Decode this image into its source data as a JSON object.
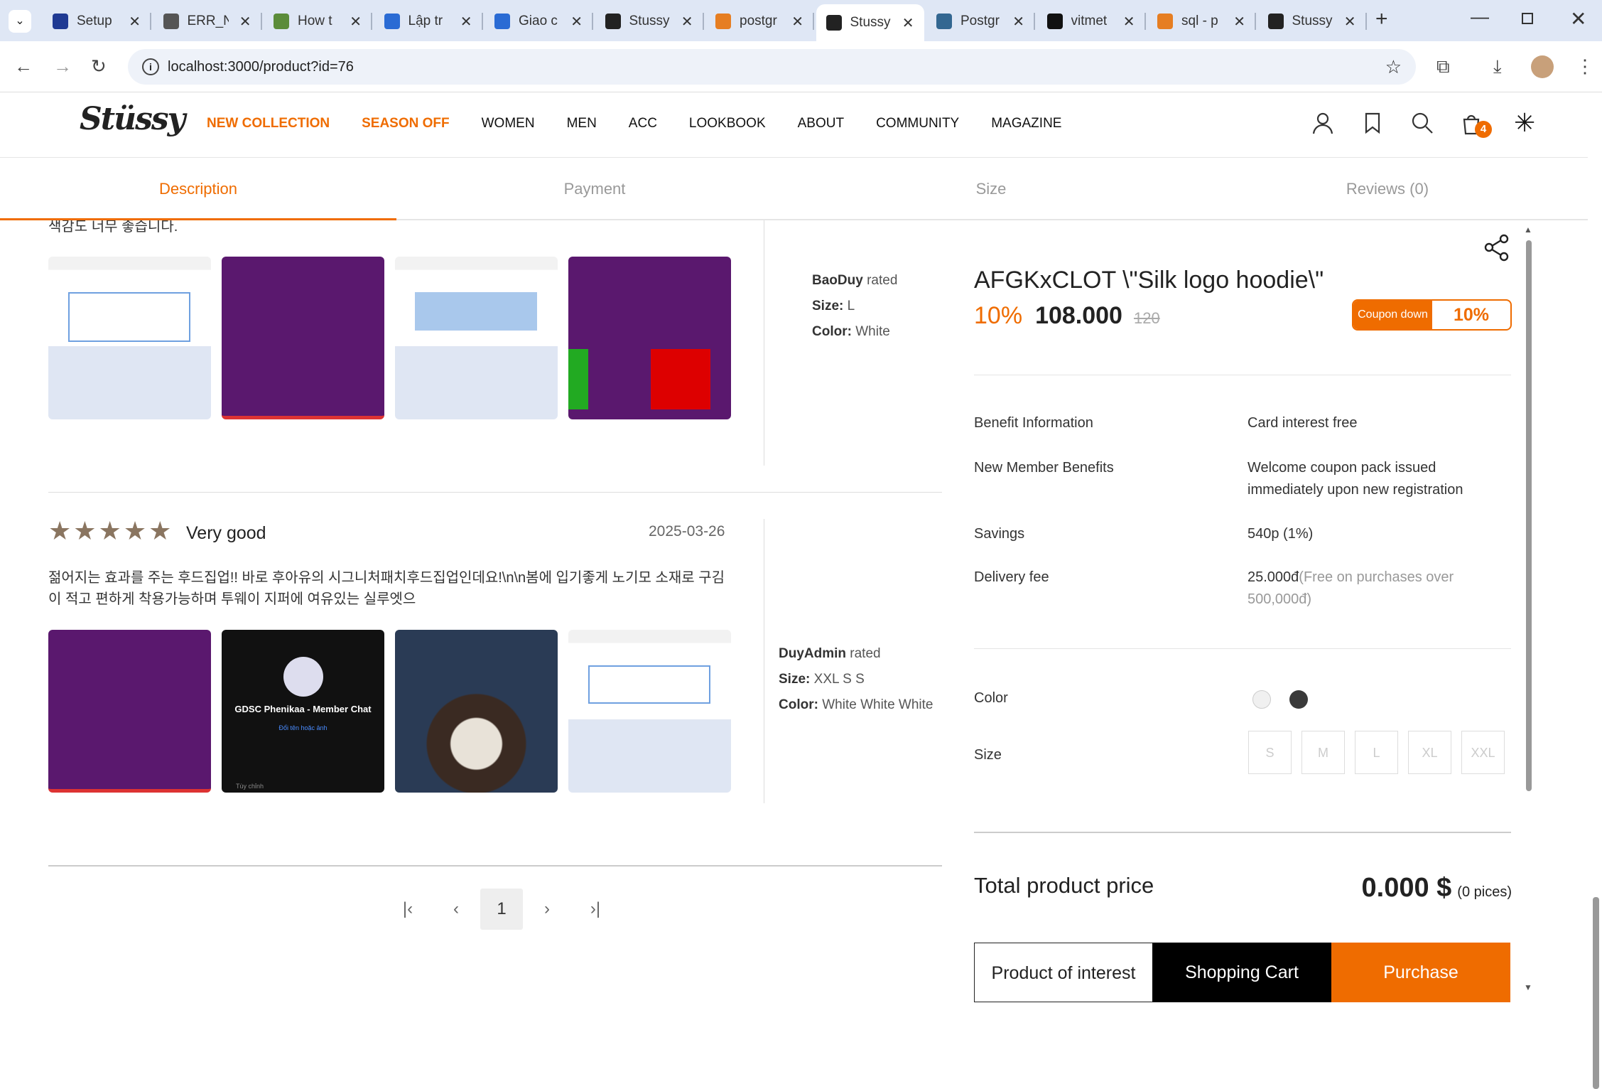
{
  "browser": {
    "tabs": [
      {
        "title": "Setup",
        "icon": "n-icon",
        "color": "#1f3a93",
        "active": false
      },
      {
        "title": "ERR_N",
        "icon": "globe-icon",
        "color": "#555",
        "active": false
      },
      {
        "title": "How t",
        "icon": "green-icon",
        "color": "#5b8c3a",
        "active": false
      },
      {
        "title": "Lập tr",
        "icon": "diamond-icon",
        "color": "#2a6bd4",
        "active": false
      },
      {
        "title": "Giao c",
        "icon": "diamond-icon",
        "color": "#2a6bd4",
        "active": false
      },
      {
        "title": "Stussy",
        "icon": "stussy-icon",
        "color": "#222",
        "active": false
      },
      {
        "title": "postgr",
        "icon": "stack-icon",
        "color": "#e67e22",
        "active": false
      },
      {
        "title": "Stussy",
        "icon": "stussy-icon",
        "color": "#222",
        "active": true
      },
      {
        "title": "Postgr",
        "icon": "elephant-icon",
        "color": "#336791",
        "active": false
      },
      {
        "title": "vitmet",
        "icon": "github-icon",
        "color": "#111",
        "active": false
      },
      {
        "title": "sql - p",
        "icon": "stack-icon",
        "color": "#e67e22",
        "active": false
      },
      {
        "title": "Stussy",
        "icon": "stussy-icon",
        "color": "#222",
        "active": false
      }
    ],
    "url": "localhost:3000/product?id=76"
  },
  "site": {
    "logo": "Stüssy",
    "menu": [
      "NEW COLLECTION",
      "SEASON OFF",
      "WOMEN",
      "MEN",
      "ACC",
      "LOOKBOOK",
      "ABOUT",
      "COMMUNITY",
      "MAGAZINE"
    ],
    "cart_count": "4"
  },
  "product_tabs": [
    "Description",
    "Payment",
    "Size",
    "Reviews (0)"
  ],
  "reviews": [
    {
      "text": "색감도 너무 좋습니다.",
      "user": "BaoDuy",
      "rated": "rated",
      "size_label": "Size:",
      "size": "L",
      "color_label": "Color:",
      "color": "White"
    },
    {
      "title": "Very good",
      "date": "2025-03-26",
      "text": "젊어지는 효과를 주는 후드집업!! 바로 후아유의 시그니처패치후드집업인데요!\\n\\n봄에 입기좋게 노기모 소재로 구김이 적고 편하게 착용가능하며 투웨이 지퍼에 여유있는 실루엣으",
      "user": "DuyAdmin",
      "rated": "rated",
      "size_label": "Size:",
      "size": "XXL S S",
      "color_label": "Color:",
      "color": "White White White",
      "thumb_texts": [
        "GDSC Phenikaa - Member Chat",
        "Đổi tên hoặc ảnh",
        "Tùy chỉnh"
      ]
    }
  ],
  "pagination": {
    "current": "1"
  },
  "product": {
    "name": "AFGKxCLOT \\\"Silk logo hoodie\\\"",
    "discount": "10%",
    "price": "108.000",
    "old_price": "120",
    "coupon_label": "Coupon down",
    "coupon_value": "10%",
    "info": [
      {
        "k": "Benefit Information",
        "v": "Card interest free"
      },
      {
        "k": "New Member Benefits",
        "v": "Welcome coupon pack issued immediately upon new registration"
      },
      {
        "k": "Savings",
        "v": "540p (1%)"
      },
      {
        "k": "Delivery fee",
        "v": "25.000đ",
        "note": "(Free on purchases over 500,000đ)"
      }
    ],
    "color_label": "Color",
    "colors": [
      "#f0f0f0",
      "#3a3a3a"
    ],
    "size_label": "Size",
    "sizes": [
      "S",
      "M",
      "L",
      "XL",
      "XXL"
    ],
    "total_label": "Total product price",
    "total": "0.000 $",
    "pieces": "(0 pices)",
    "btn_interest": "Product of interest",
    "btn_cart": "Shopping Cart",
    "btn_purchase": "Purchase"
  },
  "colors": {
    "accent": "#ef6c00",
    "star": "#8a7560"
  }
}
